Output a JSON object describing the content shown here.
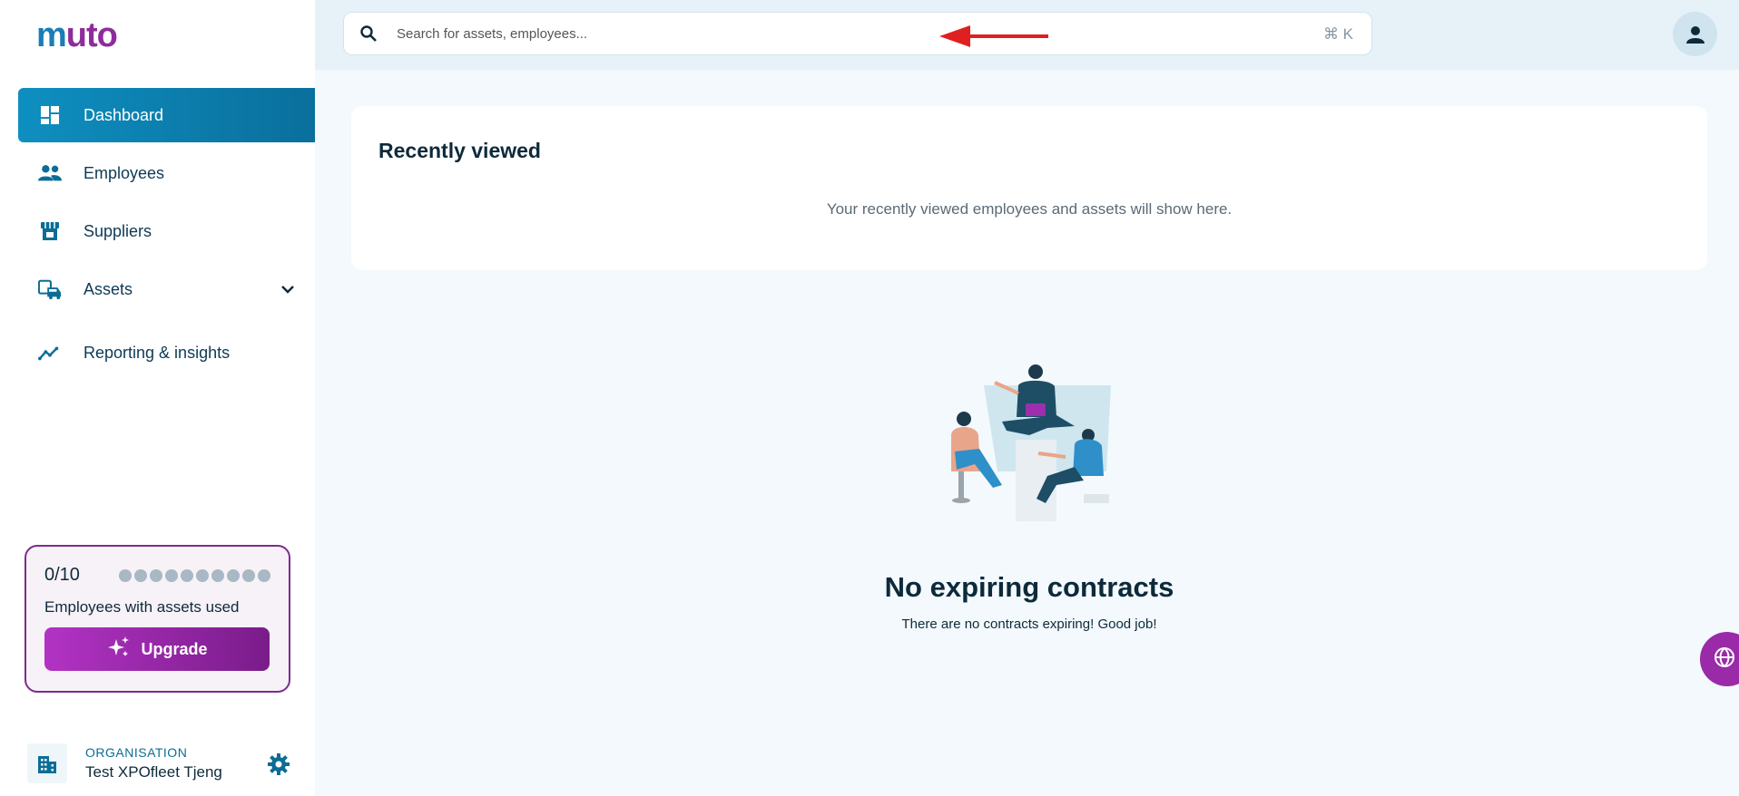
{
  "brand": {
    "logo_part1": "m",
    "logo_part2": "uto"
  },
  "sidebar": {
    "items": [
      {
        "label": "Dashboard",
        "icon": "dashboard-icon"
      },
      {
        "label": "Employees",
        "icon": "people-icon"
      },
      {
        "label": "Suppliers",
        "icon": "store-icon"
      },
      {
        "label": "Assets",
        "icon": "vehicle-icon"
      },
      {
        "label": "Reporting & insights",
        "icon": "trend-icon"
      }
    ]
  },
  "usage": {
    "count": "0/10",
    "used": 0,
    "total": 10,
    "label": "Employees with assets used",
    "upgrade_label": "Upgrade"
  },
  "organisation": {
    "label": "ORGANISATION",
    "name": "Test XPOfleet Tjeng"
  },
  "search": {
    "placeholder": "Search for assets, employees...",
    "shortcut": "⌘ K"
  },
  "recent": {
    "title": "Recently viewed",
    "empty_text": "Your recently viewed employees and assets will show here."
  },
  "contracts": {
    "title": "No expiring contracts",
    "subtitle": "There are no contracts expiring! Good job!"
  },
  "colors": {
    "primary": "#0e8fc0",
    "accent": "#9a2aa8",
    "annotation": "#e02020"
  }
}
